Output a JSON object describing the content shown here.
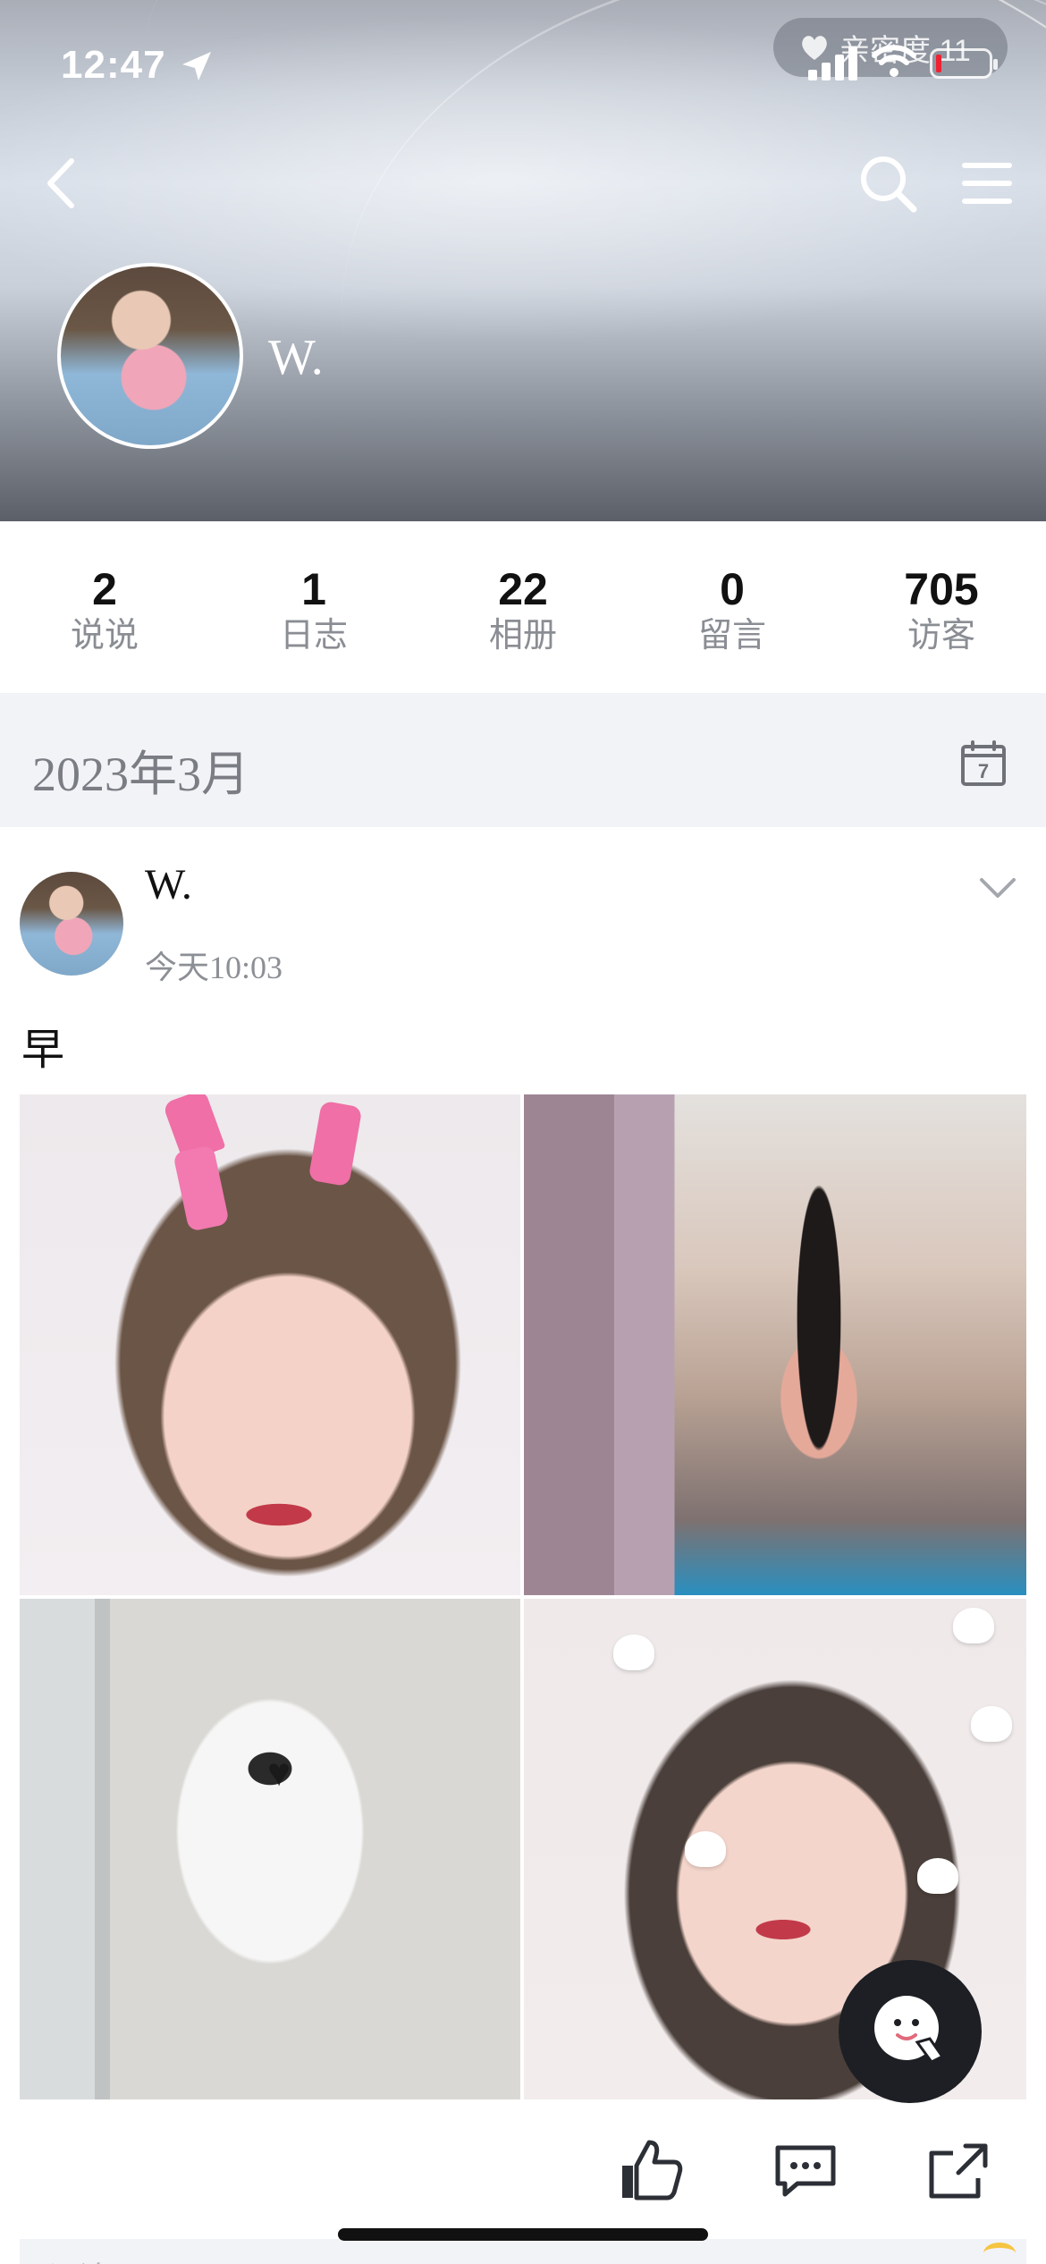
{
  "status_bar": {
    "time": "12:47",
    "intimacy_label": "亲密度 11"
  },
  "profile": {
    "name": "W."
  },
  "stats": [
    {
      "value": "2",
      "label": "说说"
    },
    {
      "value": "1",
      "label": "日志"
    },
    {
      "value": "22",
      "label": "相册"
    },
    {
      "value": "0",
      "label": "留言"
    },
    {
      "value": "705",
      "label": "访客"
    }
  ],
  "timeline": {
    "month": "2023年3月",
    "calendar_day": "7"
  },
  "post": {
    "author": "W.",
    "time": "今天10:03",
    "text": "早",
    "photos": [
      "selfie-pink-clips",
      "mirror-back-room",
      "mirror-white-tshirt",
      "selfie-hearts"
    ]
  },
  "comment_placeholder": "评论",
  "colors": {
    "stat_number": "#111111",
    "stat_label": "#8a8d93",
    "month_bar_bg": "#f2f3f7",
    "bot_button": "#1d1f24"
  },
  "icons": [
    "back-icon",
    "search-icon",
    "menu-icon",
    "calendar-icon",
    "chevron-down-icon",
    "like-icon",
    "comment-icon",
    "share-icon",
    "assistant-icon",
    "heart-icon",
    "location-icon"
  ]
}
